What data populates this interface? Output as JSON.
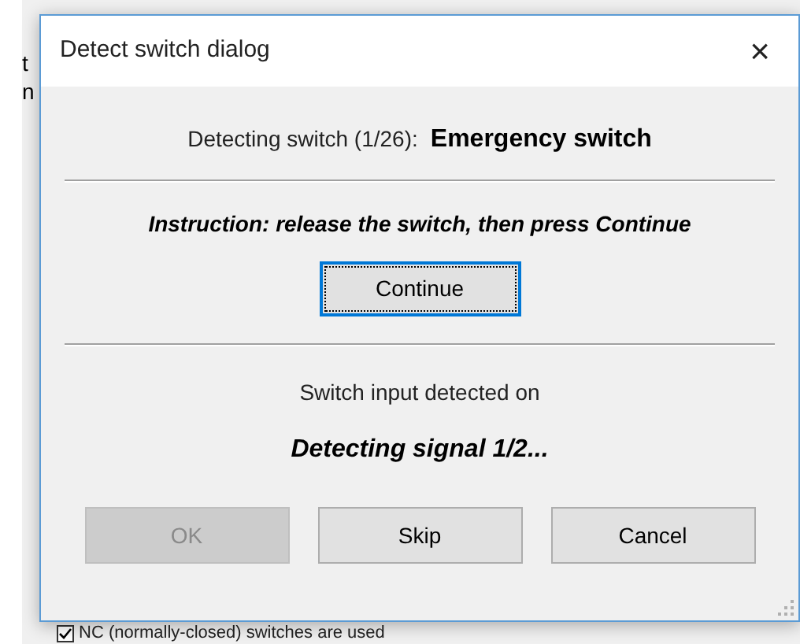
{
  "background_window": {
    "fragments": [
      "t",
      "n"
    ],
    "checkbox": {
      "label": "NC (normally-closed) switches are used",
      "checked": true
    }
  },
  "dialog": {
    "title": "Detect switch dialog",
    "close": "×",
    "progress_label": "Detecting switch (1/26):",
    "switch_name": "Emergency switch",
    "instruction": "Instruction: release the switch, then press Continue",
    "continue_button": {
      "label": "Continue",
      "focused": true
    },
    "detected_label": "Switch input detected on",
    "status": "Detecting signal 1/2...",
    "buttons": [
      {
        "label": "OK",
        "disabled": true
      },
      {
        "label": "Skip",
        "disabled": false
      },
      {
        "label": "Cancel",
        "disabled": false
      }
    ]
  }
}
